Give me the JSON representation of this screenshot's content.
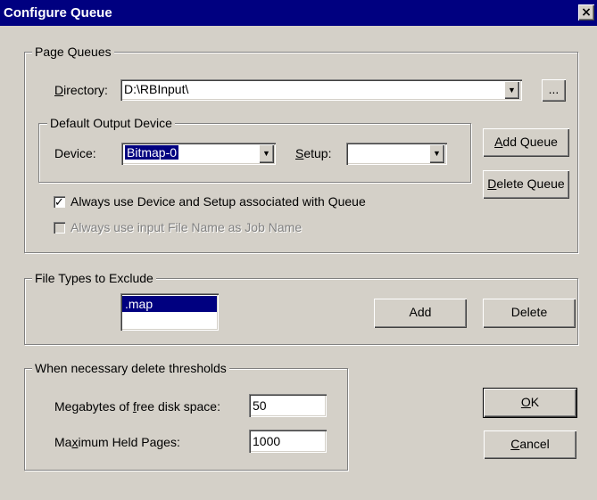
{
  "window": {
    "title": "Configure Queue",
    "close_glyph": "×"
  },
  "page_queues": {
    "legend": "Page Queues",
    "directory_label": "Directory:",
    "directory_mnemonic": "D",
    "directory_rest": "irectory:",
    "directory_value": "D:\\RBInput\\",
    "browse_label": "...",
    "default_output_legend": "Default Output Device",
    "device_label": "Device:",
    "device_value": "Bitmap-0",
    "setup_label_mnemonic": "S",
    "setup_label_rest": "etup:",
    "setup_value": "",
    "add_queue_mn": "A",
    "add_queue_rest": "dd Queue",
    "delete_queue_mn": "D",
    "delete_queue_rest": "elete Queue",
    "always_use_device_label": "Always use Device and Setup associated with Queue",
    "always_use_device_checked": true,
    "always_use_filename_label": "Always use input File Name as Job Name",
    "always_use_filename_checked": false
  },
  "file_types": {
    "legend": "File Types to Exclude",
    "items": [
      ".map"
    ],
    "add_label": "Add",
    "delete_label": "Delete"
  },
  "thresholds": {
    "legend": "When necessary delete thresholds",
    "free_space_pre": "Megabytes of ",
    "free_space_mn": "f",
    "free_space_post": "ree disk space:",
    "free_space_value": "50",
    "max_held_pre": "Ma",
    "max_held_mn": "x",
    "max_held_post": "imum Held Pages:",
    "max_held_value": "1000"
  },
  "buttons": {
    "ok_mn": "O",
    "ok_rest": "K",
    "cancel_mn": "C",
    "cancel_rest": "ancel"
  },
  "icons": {
    "dropdown": "triangle-down",
    "check": "checkmark"
  }
}
